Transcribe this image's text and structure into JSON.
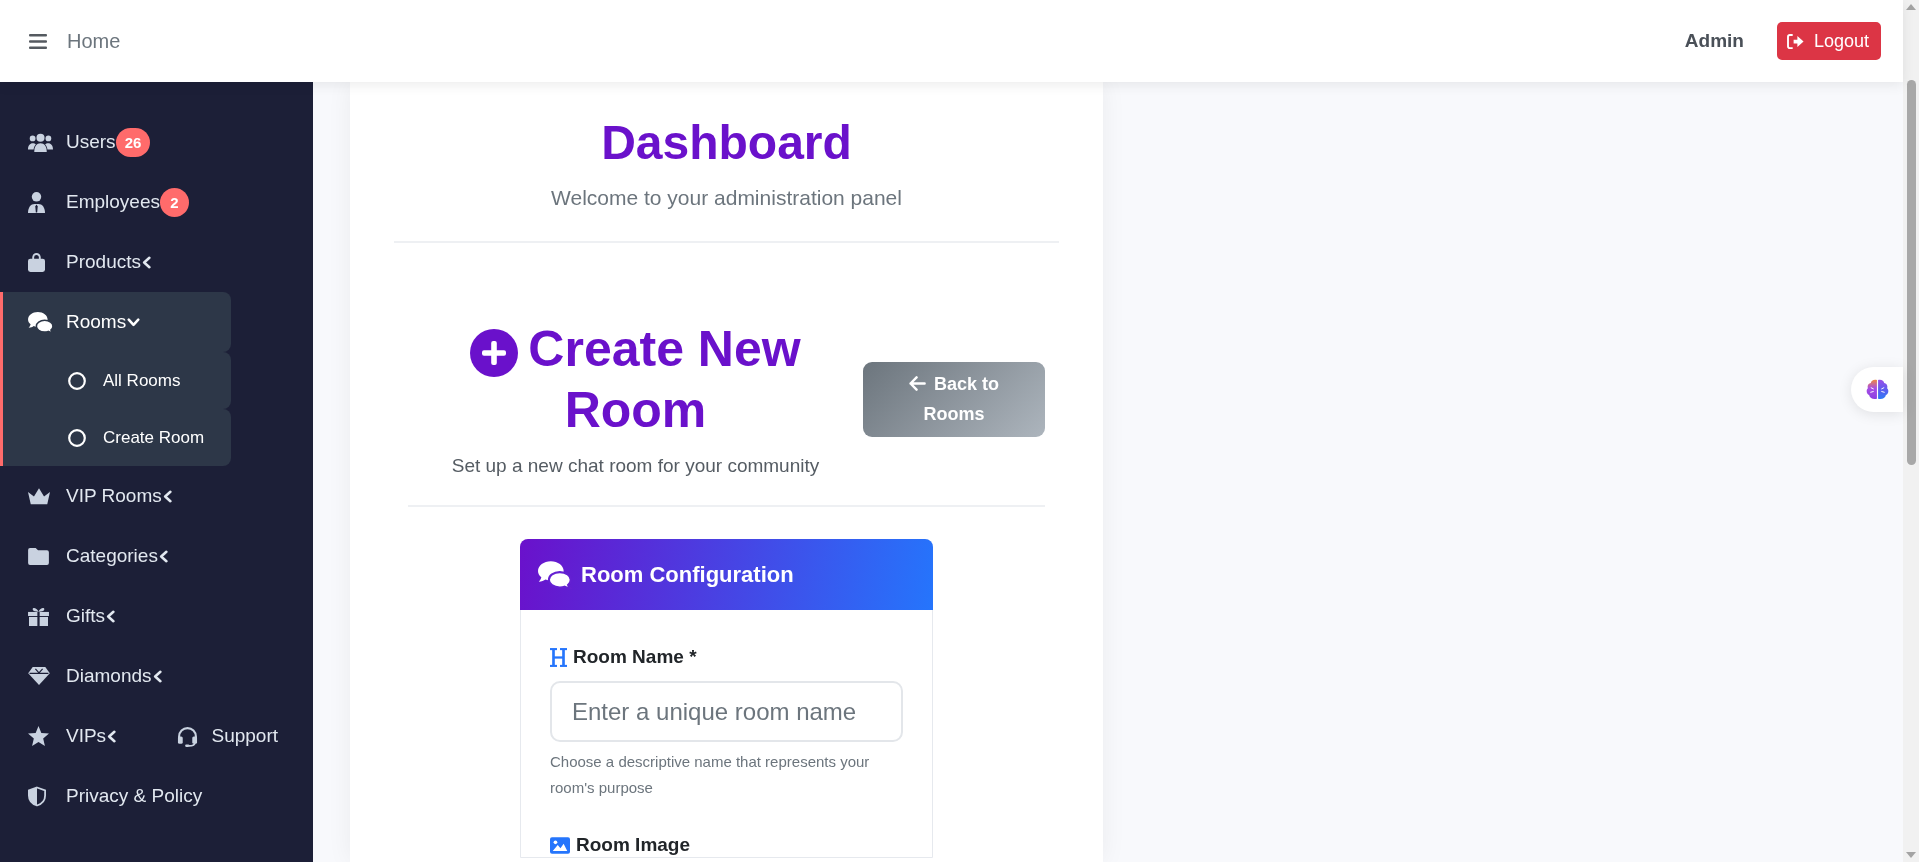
{
  "header": {
    "breadcrumb": "Home",
    "user_name": "Admin",
    "logout_button": "Logout"
  },
  "sidebar": {
    "items": [
      {
        "label": "Users",
        "kind": "link",
        "badge": "26",
        "selected": false
      },
      {
        "label": "Employees",
        "kind": "link",
        "badge": "2",
        "selected": false
      },
      {
        "label": "Products",
        "kind": "menu",
        "expanded": false,
        "selected": false
      },
      {
        "label": "Rooms",
        "kind": "menu",
        "expanded": true,
        "selected": true,
        "children": [
          {
            "label": "All Rooms"
          },
          {
            "label": "Create Room"
          }
        ]
      },
      {
        "label": "VIP Rooms",
        "kind": "menu",
        "expanded": false,
        "selected": false
      },
      {
        "label": "Categories",
        "kind": "menu",
        "expanded": false,
        "selected": false
      },
      {
        "label": "Gifts",
        "kind": "menu",
        "expanded": false,
        "selected": false
      },
      {
        "label": "Diamonds",
        "kind": "menu",
        "expanded": false,
        "selected": false
      },
      {
        "label": "VIPs",
        "kind": "menu",
        "expanded": false,
        "selected": false,
        "side_link": {
          "label": "Support"
        }
      },
      {
        "label": "Privacy & Policy",
        "kind": "link",
        "selected": false
      }
    ]
  },
  "dashboard": {
    "title": "Dashboard",
    "subtitle": "Welcome to your administration panel"
  },
  "create_room": {
    "title": "Create New Room",
    "subtitle": "Set up a new chat room for your community",
    "back_button": "Back to Rooms"
  },
  "form_card": {
    "title": "Room Configuration",
    "fields": [
      {
        "kind": "text",
        "label": "Room Name *",
        "placeholder": "Enter a unique room name",
        "help": "Choose a descriptive name that represents your room's purpose"
      },
      {
        "kind": "image",
        "label": "Room Image"
      }
    ]
  }
}
